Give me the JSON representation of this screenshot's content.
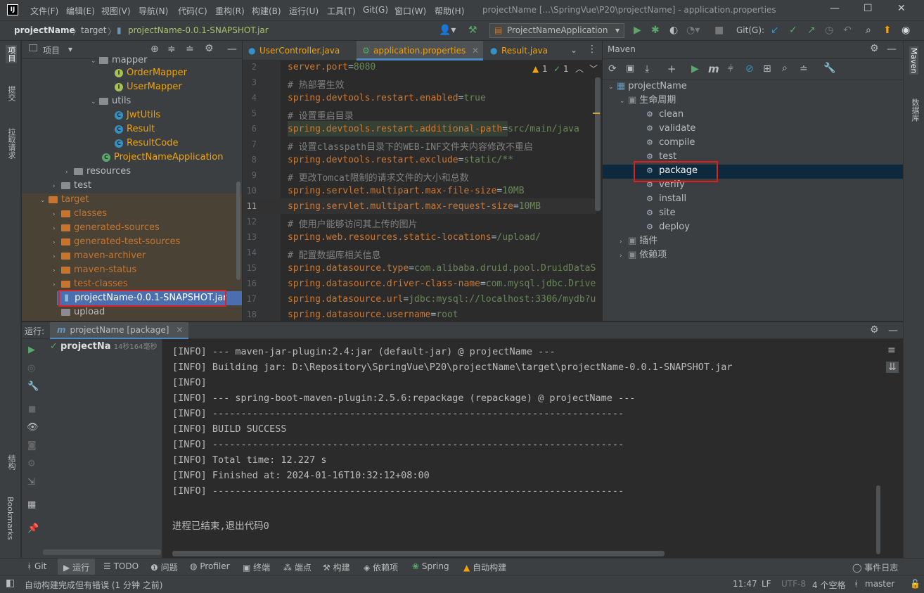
{
  "menubar": {
    "logo": "IJ",
    "items": [
      "文件(F)",
      "编辑(E)",
      "视图(V)",
      "导航(N)",
      "代码(C)",
      "重构(R)",
      "构建(B)",
      "运行(U)",
      "工具(T)",
      "Git(G)",
      "窗口(W)",
      "帮助(H)"
    ],
    "window_title": "projectName [...\\SpringVue\\P20\\projectName] - application.properties"
  },
  "navbar": {
    "breadcrumb": [
      "projectName",
      "target",
      "projectName-0.0.1-SNAPSHOT.jar"
    ],
    "run_config": "ProjectNameApplication",
    "git_label": "Git(G):"
  },
  "left_strip": {
    "project": "项目",
    "commit": "提交",
    "pull_requests": "拉取请求",
    "structure": "结构",
    "bookmarks": "Bookmarks"
  },
  "right_strip": {
    "maven": "Maven",
    "database": "数据库"
  },
  "project_panel": {
    "title": "项目",
    "tree": [
      {
        "label": "mapper",
        "kind": "folder",
        "level": 5,
        "expanded": true
      },
      {
        "label": "OrderMapper",
        "kind": "interface",
        "level": 6
      },
      {
        "label": "UserMapper",
        "kind": "interface",
        "level": 6
      },
      {
        "label": "utils",
        "kind": "folder",
        "level": 5,
        "expanded": true
      },
      {
        "label": "JwtUtils",
        "kind": "class",
        "level": 6
      },
      {
        "label": "Result",
        "kind": "class",
        "level": 6
      },
      {
        "label": "ResultCode",
        "kind": "class",
        "level": 6
      },
      {
        "label": "ProjectNameApplication",
        "kind": "spring",
        "level": 5
      },
      {
        "label": "resources",
        "kind": "folder",
        "level": 4
      },
      {
        "label": "test",
        "kind": "folder",
        "level": 3
      },
      {
        "label": "target",
        "kind": "folder-orange",
        "level": 2,
        "expanded": true
      },
      {
        "label": "classes",
        "kind": "folder-orange",
        "level": 3
      },
      {
        "label": "generated-sources",
        "kind": "folder-orange",
        "level": 3
      },
      {
        "label": "generated-test-sources",
        "kind": "folder-orange",
        "level": 3
      },
      {
        "label": "maven-archiver",
        "kind": "folder-orange",
        "level": 3
      },
      {
        "label": "maven-status",
        "kind": "folder-orange",
        "level": 3
      },
      {
        "label": "test-classes",
        "kind": "folder-orange",
        "level": 3
      },
      {
        "label": "projectName-0.0.1-SNAPSHOT.jar",
        "kind": "jar",
        "level": 3,
        "selected": true
      },
      {
        "label": "upload",
        "kind": "folder",
        "level": 2
      }
    ]
  },
  "editor": {
    "tabs": [
      "UserController.java",
      "application.properties",
      "Result.java"
    ],
    "active_tab": "application.properties",
    "inspection": {
      "warnings": "1",
      "ok": "1"
    },
    "lines": [
      {
        "n": "2",
        "key": "server.port",
        "eq": "=",
        "val": "8080"
      },
      {
        "n": "3",
        "comment": "# 热部署生效"
      },
      {
        "n": "4",
        "key": "spring.devtools.restart.enabled",
        "eq": "=",
        "val": "true"
      },
      {
        "n": "5",
        "comment": "# 设置重启目录"
      },
      {
        "n": "6",
        "key": "spring.devtools.restart.additional-path",
        "eq": "=",
        "val": "src/main/java"
      },
      {
        "n": "7",
        "comment": "# 设置classpath目录下的WEB-INF文件夹内容修改不重启"
      },
      {
        "n": "8",
        "key": "spring.devtools.restart.exclude",
        "eq": "=",
        "val": "static/**"
      },
      {
        "n": "9",
        "comment": "#  更改Tomcat限制的请求文件的大小和总数"
      },
      {
        "n": "10",
        "key": "spring.servlet.multipart.max-file-size",
        "eq": "=",
        "val": "10MB"
      },
      {
        "n": "11",
        "key": "spring.servlet.multipart.max-request-size",
        "eq": "=",
        "val": "10MB"
      },
      {
        "n": "12",
        "comment": "#  使用户能够访问其上传的图片"
      },
      {
        "n": "13",
        "key": "spring.web.resources.static-locations",
        "eq": "=",
        "val": "/upload/"
      },
      {
        "n": "14",
        "comment": "#  配置数据库相关信息"
      },
      {
        "n": "15",
        "key": "spring.datasource.type",
        "eq": "=",
        "val": "com.alibaba.druid.pool.DruidDataS"
      },
      {
        "n": "16",
        "key": "spring.datasource.driver-class-name",
        "eq": "=",
        "val": "com.mysql.jdbc.Drive"
      },
      {
        "n": "17",
        "key": "spring.datasource.url",
        "eq": "=",
        "val": "jdbc:mysql://localhost:3306/mydb?u"
      },
      {
        "n": "18",
        "key": "spring.datasource.username",
        "eq": "=",
        "val": "root"
      }
    ]
  },
  "maven": {
    "title": "Maven",
    "root": "projectName",
    "lifecycle_label": "生命周期",
    "goals": [
      "clean",
      "validate",
      "compile",
      "test",
      "package",
      "verify",
      "install",
      "site",
      "deploy"
    ],
    "selected_goal": "package",
    "plugins_label": "插件",
    "deps_label": "依赖项"
  },
  "run": {
    "label": "运行:",
    "tab": "projectName [package]",
    "tree_item": "projectNa",
    "tree_time": "14秒164毫秒",
    "console": [
      "[INFO] --- maven-jar-plugin:2.4:jar (default-jar) @ projectName ---",
      "[INFO] Building jar: D:\\Repository\\SpringVue\\P20\\projectName\\target\\projectName-0.0.1-SNAPSHOT.jar",
      "[INFO]",
      "[INFO] --- spring-boot-maven-plugin:2.5.6:repackage (repackage) @ projectName ---",
      "[INFO] ------------------------------------------------------------------------",
      "[INFO] BUILD SUCCESS",
      "[INFO] ------------------------------------------------------------------------",
      "[INFO] Total time:  12.227 s",
      "[INFO] Finished at: 2024-01-16T10:32:12+08:00",
      "[INFO] ------------------------------------------------------------------------",
      "",
      "进程已结束,退出代码0"
    ]
  },
  "bottom_tools": [
    "Git",
    "运行",
    "TODO",
    "问题",
    "Profiler",
    "终端",
    "端点",
    "构建",
    "依赖项",
    "Spring",
    "自动构建"
  ],
  "event_log": "事件日志",
  "status": {
    "message": "自动构建完成但有错误 (1 分钟 之前)",
    "time": "11:47",
    "line_sep": "LF",
    "encoding": "UTF-8",
    "indent": "4 个空格",
    "branch": "master"
  },
  "colors": {
    "accent_red": "#e02020",
    "selection": "#0d293e",
    "jar_selected": "#4b6eaf"
  }
}
